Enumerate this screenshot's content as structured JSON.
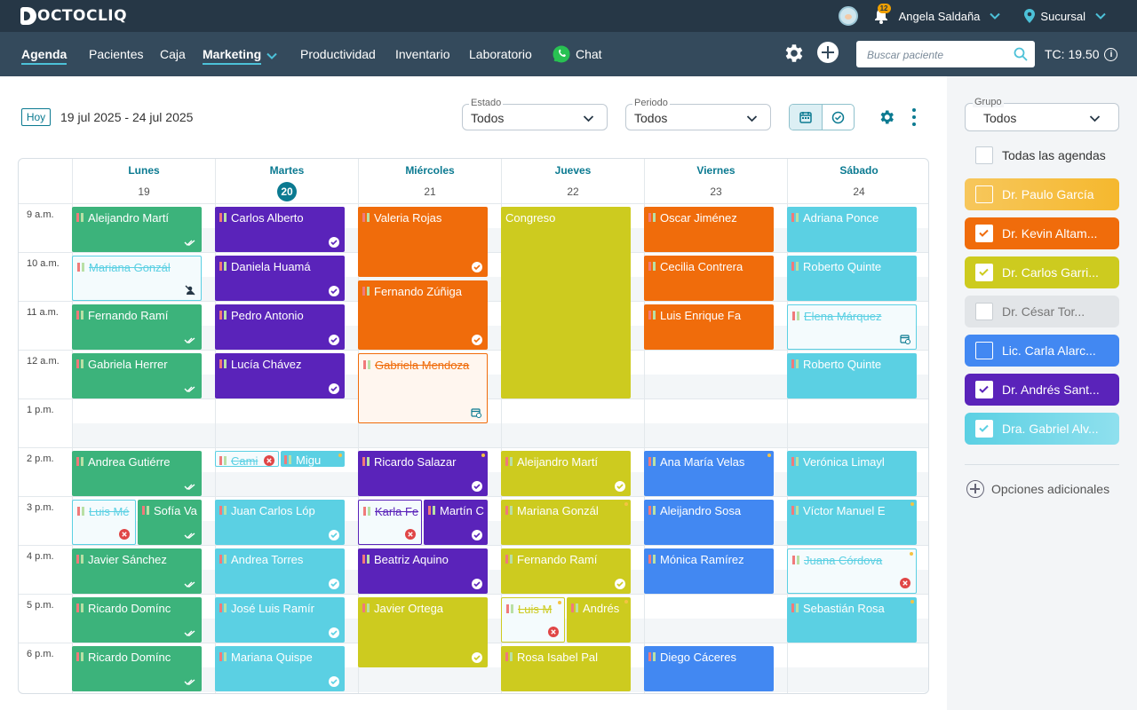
{
  "app": {
    "logo": "OCTOCLIQ"
  },
  "topbar": {
    "user_name": "Angela Saldaña",
    "notifications": "12",
    "branch": "Sucursal"
  },
  "nav": {
    "items": [
      "Agenda",
      "Pacientes",
      "Caja",
      "Marketing",
      "Productividad",
      "Inventario",
      "Laboratorio",
      "Chat"
    ],
    "active": "Agenda",
    "search_placeholder": "Buscar paciente",
    "tc": "TC: 19.50"
  },
  "toolbar": {
    "today_label": "Hoy",
    "date_range": "19 jul 2025 - 24 jul 2025",
    "estado_label": "Estado",
    "estado_value": "Todos",
    "periodo_label": "Periodo",
    "periodo_value": "Todos"
  },
  "calendar": {
    "days": [
      {
        "name": "Lunes",
        "date": "19",
        "today": false
      },
      {
        "name": "Martes",
        "date": "20",
        "today": true
      },
      {
        "name": "Miércoles",
        "date": "21",
        "today": false
      },
      {
        "name": "Jueves",
        "date": "22",
        "today": false
      },
      {
        "name": "Viernes",
        "date": "23",
        "today": false
      },
      {
        "name": "Sábado",
        "date": "24",
        "today": false
      }
    ],
    "hours": [
      "9 a.m.",
      "10 a.m.",
      "11 a.m.",
      "12 a.m.",
      "1 p.m.",
      "2 p.m.",
      "3 p.m.",
      "4 p.m.",
      "5 p.m.",
      "6 p.m."
    ],
    "events": [
      {
        "day": 0,
        "start": 0,
        "dur": 1,
        "name": "Aleijandro Martí",
        "color": "green",
        "status": "double"
      },
      {
        "day": 0,
        "start": 1,
        "dur": 1,
        "name": "Mariana Gonzál",
        "color": "cancel",
        "status": "noshow"
      },
      {
        "day": 0,
        "start": 2,
        "dur": 1,
        "name": "Fernando Ramí",
        "color": "green",
        "status": "double"
      },
      {
        "day": 0,
        "start": 3,
        "dur": 1,
        "name": "Gabriela Herrer",
        "color": "green",
        "status": "double"
      },
      {
        "day": 0,
        "start": 5,
        "dur": 1,
        "name": "Andrea Gutiérre",
        "color": "green",
        "status": "double"
      },
      {
        "day": 0,
        "start": 6,
        "dur": 1,
        "name": "Luis Mé",
        "color": "cancel",
        "status": "x",
        "split": "left"
      },
      {
        "day": 0,
        "start": 6,
        "dur": 1,
        "name": "Sofía Va",
        "color": "green",
        "status": "double",
        "split": "right"
      },
      {
        "day": 0,
        "start": 7,
        "dur": 1,
        "name": "Javier Sánchez",
        "color": "green",
        "status": "double"
      },
      {
        "day": 0,
        "start": 8,
        "dur": 1,
        "name": "Ricardo Domínc",
        "color": "green",
        "status": "double"
      },
      {
        "day": 0,
        "start": 9,
        "dur": 1,
        "name": "Ricardo Domínc",
        "color": "green",
        "status": "double"
      },
      {
        "day": 1,
        "start": 0,
        "dur": 1,
        "name": "Carlos Alberto",
        "color": "purple",
        "status": "check"
      },
      {
        "day": 1,
        "start": 1,
        "dur": 1,
        "name": "Daniela Huamá",
        "color": "purple",
        "status": "check"
      },
      {
        "day": 1,
        "start": 2,
        "dur": 1,
        "name": "Pedro Antonio",
        "color": "purple",
        "status": "check"
      },
      {
        "day": 1,
        "start": 3,
        "dur": 1,
        "name": "Lucía Chávez",
        "color": "purple",
        "status": "check"
      },
      {
        "day": 1,
        "start": 5,
        "dur": 0.4,
        "name": "Cami",
        "color": "cancel",
        "status": "xinline",
        "split": "left"
      },
      {
        "day": 1,
        "start": 5,
        "dur": 0.4,
        "name": "Migu",
        "color": "cyan",
        "status": "dot",
        "split": "right"
      },
      {
        "day": 1,
        "start": 6,
        "dur": 1,
        "name": "Juan Carlos Lóp",
        "color": "cyan",
        "status": "check"
      },
      {
        "day": 1,
        "start": 7,
        "dur": 1,
        "name": "Andrea Torres",
        "color": "cyan",
        "status": "check"
      },
      {
        "day": 1,
        "start": 8,
        "dur": 1,
        "name": "José Luis Ramír",
        "color": "cyan",
        "status": "check"
      },
      {
        "day": 1,
        "start": 9,
        "dur": 1,
        "name": "Mariana Quispe",
        "color": "cyan",
        "status": "check"
      },
      {
        "day": 2,
        "start": 0,
        "dur": 1.5,
        "name": "Valeria Rojas",
        "color": "orange",
        "status": "check"
      },
      {
        "day": 2,
        "start": 1.5,
        "dur": 1.5,
        "name": "Fernando Zúñiga",
        "color": "orange",
        "status": "check"
      },
      {
        "day": 2,
        "start": 3,
        "dur": 1.5,
        "name": "Gabriela Mendoza",
        "color": "cancelorange",
        "status": "resched"
      },
      {
        "day": 2,
        "start": 5,
        "dur": 1,
        "name": "Ricardo Salazar",
        "color": "purple",
        "status": "check",
        "dot": true
      },
      {
        "day": 2,
        "start": 6,
        "dur": 1,
        "name": "Karla Fe",
        "color": "cancelpurple",
        "status": "x",
        "split": "left"
      },
      {
        "day": 2,
        "start": 6,
        "dur": 1,
        "name": "Martín C",
        "color": "purple",
        "status": "check",
        "split": "right"
      },
      {
        "day": 2,
        "start": 7,
        "dur": 1,
        "name": "Beatriz Aquino",
        "color": "purple",
        "status": "check"
      },
      {
        "day": 2,
        "start": 8,
        "dur": 1.5,
        "name": "Javier Ortega",
        "color": "olive",
        "status": "check"
      },
      {
        "day": 3,
        "start": 0,
        "dur": 4,
        "name": "Congreso",
        "color": "olive",
        "status": "none",
        "noflag": true
      },
      {
        "day": 3,
        "start": 5,
        "dur": 1,
        "name": "Aleijandro Martí",
        "color": "olive",
        "status": "check"
      },
      {
        "day": 3,
        "start": 6,
        "dur": 1,
        "name": "Mariana Gonzál",
        "color": "olive",
        "status": "dot"
      },
      {
        "day": 3,
        "start": 7,
        "dur": 1,
        "name": "Fernando Ramí",
        "color": "olive",
        "status": "check"
      },
      {
        "day": 3,
        "start": 8,
        "dur": 1,
        "name": "Luis M",
        "color": "cancelolive",
        "status": "x",
        "split": "left",
        "dot": true
      },
      {
        "day": 3,
        "start": 8,
        "dur": 1,
        "name": "Andrés",
        "color": "olive",
        "status": "dot",
        "split": "right"
      },
      {
        "day": 3,
        "start": 9,
        "dur": 1,
        "name": "Rosa Isabel Pal",
        "color": "olive",
        "status": "none"
      },
      {
        "day": 4,
        "start": 0,
        "dur": 1,
        "name": "Oscar Jiménez",
        "color": "orange",
        "status": "none"
      },
      {
        "day": 4,
        "start": 1,
        "dur": 1,
        "name": "Cecilia Contrera",
        "color": "orange",
        "status": "none"
      },
      {
        "day": 4,
        "start": 2,
        "dur": 1,
        "name": "Luis Enrique Fa",
        "color": "orange",
        "status": "none"
      },
      {
        "day": 4,
        "start": 5,
        "dur": 1,
        "name": "Ana María Velas",
        "color": "blue",
        "status": "dot"
      },
      {
        "day": 4,
        "start": 6,
        "dur": 1,
        "name": "Aleijandro Sosa",
        "color": "blue",
        "status": "none"
      },
      {
        "day": 4,
        "start": 7,
        "dur": 1,
        "name": "Mónica Ramírez",
        "color": "blue",
        "status": "none"
      },
      {
        "day": 4,
        "start": 9,
        "dur": 1,
        "name": "Diego Cáceres",
        "color": "blue",
        "status": "none"
      },
      {
        "day": 5,
        "start": 0,
        "dur": 1,
        "name": "Adriana Ponce",
        "color": "cyan",
        "status": "none"
      },
      {
        "day": 5,
        "start": 1,
        "dur": 1,
        "name": "Roberto Quinte",
        "color": "cyan",
        "status": "none"
      },
      {
        "day": 5,
        "start": 2,
        "dur": 1,
        "name": "Elena Márquez",
        "color": "cancel",
        "status": "resched"
      },
      {
        "day": 5,
        "start": 3,
        "dur": 1,
        "name": "Roberto Quinte",
        "color": "cyan",
        "status": "none"
      },
      {
        "day": 5,
        "start": 5,
        "dur": 1,
        "name": "Verónica Limayl",
        "color": "cyan",
        "status": "none"
      },
      {
        "day": 5,
        "start": 6,
        "dur": 1,
        "name": "Víctor Manuel E",
        "color": "cyan",
        "status": "dot"
      },
      {
        "day": 5,
        "start": 7,
        "dur": 1,
        "name": "Juana Córdova",
        "color": "cancel",
        "status": "x",
        "dot": true
      },
      {
        "day": 5,
        "start": 8,
        "dur": 1,
        "name": "Sebastián Rosa",
        "color": "cyan",
        "status": "dot"
      }
    ]
  },
  "sidebar": {
    "group_label": "Grupo",
    "group_value": "Todos",
    "all_label": "Todas las agendas",
    "agendas": [
      {
        "name": "Dr. Paulo García",
        "color": "#f5b82e",
        "checked": false
      },
      {
        "name": "Dr. Kevin Altam...",
        "color": "#f06c0b",
        "checked": true
      },
      {
        "name": "Dr. Carlos Garri...",
        "color": "#cdcb1f",
        "checked": true
      },
      {
        "name": "Dr. César Tor...",
        "color": "#e2e5e8",
        "checked": false
      },
      {
        "name": "Lic. Carla Alarc...",
        "color": "#4288f2",
        "checked": false
      },
      {
        "name": "Dr. Andrés Sant...",
        "color": "#5a23ba",
        "checked": true
      },
      {
        "name": "Dra. Gabriel Alv...",
        "color": "#5bd0e3",
        "checked": true
      }
    ],
    "more_options": "Opciones adicionales"
  }
}
